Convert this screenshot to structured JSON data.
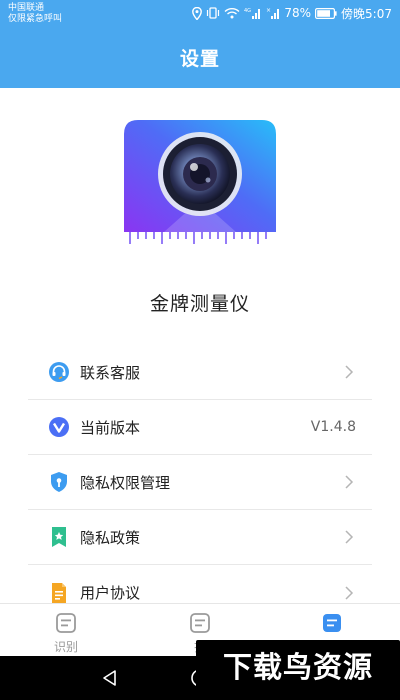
{
  "status_bar": {
    "carrier_line1": "中国联通",
    "carrier_line2": "仅限紧急呼叫",
    "battery": "78%",
    "time": "傍晚5:07",
    "network_label": "4G"
  },
  "header": {
    "title": "设置"
  },
  "app": {
    "name": "金牌测量仪",
    "logo_icon": "camera-lens-ruler-icon"
  },
  "settings": {
    "items": [
      {
        "label": "联系客服",
        "value": "",
        "icon": "headset-icon"
      },
      {
        "label": "当前版本",
        "value": "V1.4.8",
        "icon": "version-icon"
      },
      {
        "label": "隐私权限管理",
        "value": "",
        "icon": "shield-icon"
      },
      {
        "label": "隐私政策",
        "value": "",
        "icon": "bookmark-star-icon"
      },
      {
        "label": "用户协议",
        "value": "",
        "icon": "document-icon"
      }
    ]
  },
  "tabs": [
    {
      "label": "识别",
      "active": false,
      "icon": "recognize-icon"
    },
    {
      "label": "扫",
      "active": false,
      "icon": "scan-icon"
    },
    {
      "label": "",
      "active": true,
      "icon": "settings-tab-icon"
    }
  ],
  "watermark": {
    "text": "下载鸟资源"
  },
  "colors": {
    "primary": "#4aa8ef",
    "active_tab": "#3a8ff0",
    "inactive_tab": "#9a9a9a"
  }
}
